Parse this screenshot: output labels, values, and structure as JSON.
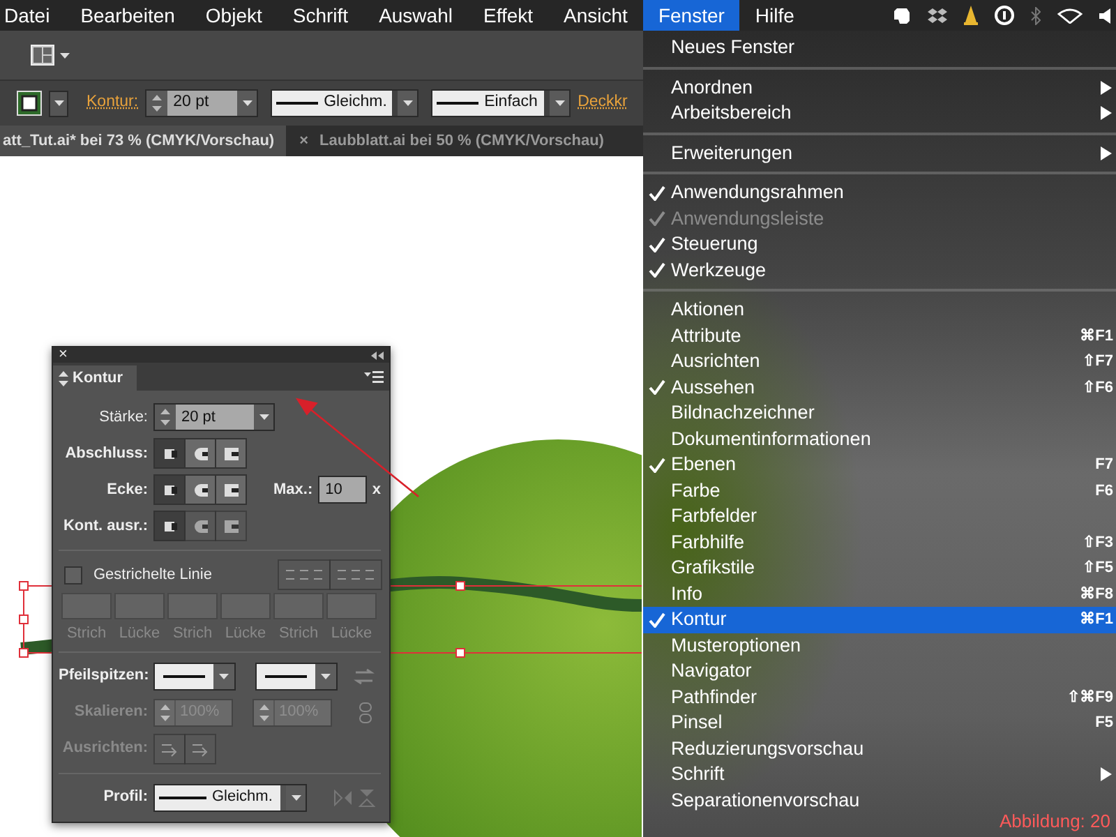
{
  "menubar": {
    "items": [
      {
        "label": "Datei",
        "selected": false
      },
      {
        "label": "Bearbeiten",
        "selected": false
      },
      {
        "label": "Objekt",
        "selected": false
      },
      {
        "label": "Schrift",
        "selected": false
      },
      {
        "label": "Auswahl",
        "selected": false
      },
      {
        "label": "Effekt",
        "selected": false
      },
      {
        "label": "Ansicht",
        "selected": false
      },
      {
        "label": "Fenster",
        "selected": true
      },
      {
        "label": "Hilfe",
        "selected": false
      }
    ]
  },
  "control_bar": {
    "stroke_label": "Kontur:",
    "stroke_weight": "20 pt",
    "profile": "Gleichm.",
    "brush": "Einfach",
    "opacity_label": "Deckkr"
  },
  "doc_tabs": [
    {
      "label": "att_Tut.ai* bei 73 % (CMYK/Vorschau)",
      "selected": true
    },
    {
      "label": "Laubblatt.ai bei 50 % (CMYK/Vorschau)",
      "selected": false,
      "close": "×"
    }
  ],
  "panel": {
    "close": "×",
    "title": "Kontur",
    "weight_label": "Stärke:",
    "weight": "20 pt",
    "cap_label": "Abschluss:",
    "caps": [
      {
        "selected": true
      },
      {
        "selected": false
      },
      {
        "selected": false
      }
    ],
    "corner_label": "Ecke:",
    "corners": [
      {
        "selected": true
      },
      {
        "selected": false
      },
      {
        "selected": false
      }
    ],
    "miter_label": "Max.:",
    "miter": "10",
    "miter_unit": "x",
    "align_label": "Kont. ausr.:",
    "aligns": [
      {
        "selected": true
      },
      {
        "selected": false
      },
      {
        "selected": false
      }
    ],
    "dashes": {
      "label": "Gestrichelte Linie",
      "checked": false,
      "disabled": true,
      "fields": [
        {
          "label": "Strich"
        },
        {
          "label": "Lücke"
        },
        {
          "label": "Strich"
        },
        {
          "label": "Lücke"
        },
        {
          "label": "Strich"
        },
        {
          "label": "Lücke"
        }
      ]
    },
    "arrowheads_label": "Pfeilspitzen:",
    "scale": {
      "label": "Skalieren:",
      "start": "100%",
      "end": "100%",
      "disabled": true
    },
    "arrow_align": {
      "label": "Ausrichten:",
      "disabled": true
    },
    "profile_label": "Profil:",
    "profile": "Gleichm."
  },
  "menu": {
    "sections": [
      {
        "items": [
          {
            "label": "Neues Fenster",
            "checked": false,
            "disabled": false,
            "selected": false,
            "submenu": false
          }
        ]
      },
      {
        "items": [
          {
            "label": "Anordnen",
            "checked": false,
            "disabled": false,
            "selected": false,
            "submenu": true
          },
          {
            "label": "Arbeitsbereich",
            "checked": false,
            "disabled": false,
            "selected": false,
            "submenu": true
          }
        ]
      },
      {
        "items": [
          {
            "label": "Erweiterungen",
            "checked": false,
            "disabled": false,
            "selected": false,
            "submenu": true
          }
        ]
      },
      {
        "items": [
          {
            "label": "Anwendungsrahmen",
            "checked": true,
            "disabled": false,
            "selected": false,
            "submenu": false
          },
          {
            "label": "Anwendungsleiste",
            "checked": true,
            "disabled": true,
            "selected": false,
            "submenu": false
          },
          {
            "label": "Steuerung",
            "checked": true,
            "disabled": false,
            "selected": false,
            "submenu": false
          },
          {
            "label": "Werkzeuge",
            "checked": true,
            "disabled": false,
            "selected": false,
            "submenu": false
          }
        ]
      },
      {
        "items": [
          {
            "label": "Aktionen",
            "checked": false,
            "disabled": false,
            "selected": false,
            "submenu": false
          },
          {
            "label": "Attribute",
            "checked": false,
            "disabled": false,
            "selected": false,
            "submenu": false,
            "shortcut": "⌘F1"
          },
          {
            "label": "Ausrichten",
            "checked": false,
            "disabled": false,
            "selected": false,
            "submenu": false,
            "shortcut": "⇧F7"
          },
          {
            "label": "Aussehen",
            "checked": true,
            "disabled": false,
            "selected": false,
            "submenu": false,
            "shortcut": "⇧F6"
          },
          {
            "label": "Bildnachzeichner",
            "checked": false,
            "disabled": false,
            "selected": false,
            "submenu": false
          },
          {
            "label": "Dokumentinformationen",
            "checked": false,
            "disabled": false,
            "selected": false,
            "submenu": false
          },
          {
            "label": "Ebenen",
            "checked": true,
            "disabled": false,
            "selected": false,
            "submenu": false,
            "shortcut": "F7"
          },
          {
            "label": "Farbe",
            "checked": false,
            "disabled": false,
            "selected": false,
            "submenu": false,
            "shortcut": "F6"
          },
          {
            "label": "Farbfelder",
            "checked": false,
            "disabled": false,
            "selected": false,
            "submenu": false
          },
          {
            "label": "Farbhilfe",
            "checked": false,
            "disabled": false,
            "selected": false,
            "submenu": false,
            "shortcut": "⇧F3"
          },
          {
            "label": "Grafikstile",
            "checked": false,
            "disabled": false,
            "selected": false,
            "submenu": false,
            "shortcut": "⇧F5"
          },
          {
            "label": "Info",
            "checked": false,
            "disabled": false,
            "selected": false,
            "submenu": false,
            "shortcut": "⌘F8"
          },
          {
            "label": "Kontur",
            "checked": true,
            "disabled": false,
            "selected": true,
            "submenu": false,
            "shortcut": "⌘F1"
          },
          {
            "label": "Musteroptionen",
            "checked": false,
            "disabled": false,
            "selected": false,
            "submenu": false
          },
          {
            "label": "Navigator",
            "checked": false,
            "disabled": false,
            "selected": false,
            "submenu": false
          },
          {
            "label": "Pathfinder",
            "checked": false,
            "disabled": false,
            "selected": false,
            "submenu": false,
            "shortcut": "⇧⌘F9"
          },
          {
            "label": "Pinsel",
            "checked": false,
            "disabled": false,
            "selected": false,
            "submenu": false,
            "shortcut": "F5"
          },
          {
            "label": "Reduzierungsvorschau",
            "checked": false,
            "disabled": false,
            "selected": false,
            "submenu": false
          },
          {
            "label": "Schrift",
            "checked": false,
            "disabled": false,
            "selected": false,
            "submenu": true
          },
          {
            "label": "Separationenvorschau",
            "checked": false,
            "disabled": false,
            "selected": false,
            "submenu": false
          }
        ]
      }
    ]
  },
  "figure_label": "Abbildung: 20"
}
